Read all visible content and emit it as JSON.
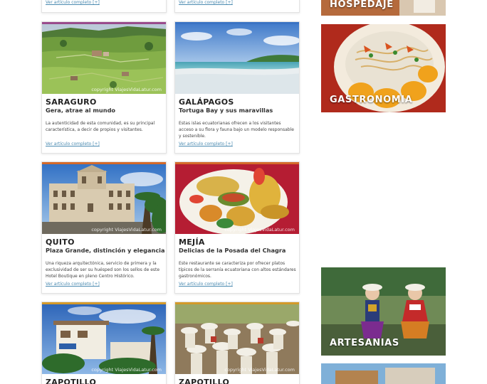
{
  "top_cards": [
    {
      "more_label": "Ver artículo completo [+]"
    },
    {
      "more_label": "Ver artículo completo [+]"
    }
  ],
  "cards": [
    {
      "place": "SARAGURO",
      "subtitle": "Gera, atrae al mundo",
      "description": "La autenticidad de esta comunidad, es su principal característica, a decir de propios y visitantes.",
      "more_label": "Ver artículo completo [+]",
      "copyright": "copyright ViajesVidaLatur.com",
      "accent": "#9a4b8c"
    },
    {
      "place": "GALÁPAGOS",
      "subtitle": "Tortuga Bay y sus maravillas",
      "description": "Estas islas ecuatorianas ofrecen a los visitantes acceso a su flora y fauna bajo un modelo responsable y sostenible.",
      "more_label": "Ver artículo completo [+]",
      "copyright": "",
      "accent": "#3b73c4"
    },
    {
      "place": "QUITO",
      "subtitle": "Plaza Grande, distinción y elegancia",
      "description": "Una riqueza arquitectónica, servicio de primera y la exclusividad de ser su huésped son los sellos de este Hotel Boutique en pleno Centro Histórico.",
      "more_label": "Ver artículo completo [+]",
      "copyright": "copyright ViajesVidaLatur.com",
      "accent": "#d46a2a"
    },
    {
      "place": "MEJÍA",
      "subtitle": "Delicias de la Posada del Chagra",
      "description": "Este restaurante se caracteriza por ofrecer platos típicos de la serranía ecuatoriana con altos estándares gastronómicos.",
      "more_label": "Ver artículo completo [+]",
      "copyright": "copyright ViajesVidaLatur.com",
      "accent": "#d46a2a"
    },
    {
      "place": "ZAPOTILLO",
      "subtitle": "",
      "description": "",
      "more_label": "",
      "copyright": "copyright ViajesVidaLatur.com",
      "accent": "#d49a2a"
    },
    {
      "place": "ZAPOTILLO",
      "subtitle": "",
      "description": "",
      "more_label": "",
      "copyright": "copyright ViajesVidaLatur.com",
      "accent": "#d49a2a"
    }
  ],
  "sidebar": {
    "promos": [
      {
        "label": "HOSPEDAJE"
      },
      {
        "label": "GASTRONOMIA"
      },
      {
        "label": "ARTESANIAS"
      }
    ]
  },
  "colors": {
    "link": "#4a8ab0",
    "title": "#222222",
    "card_border": "#e3e3e3"
  }
}
